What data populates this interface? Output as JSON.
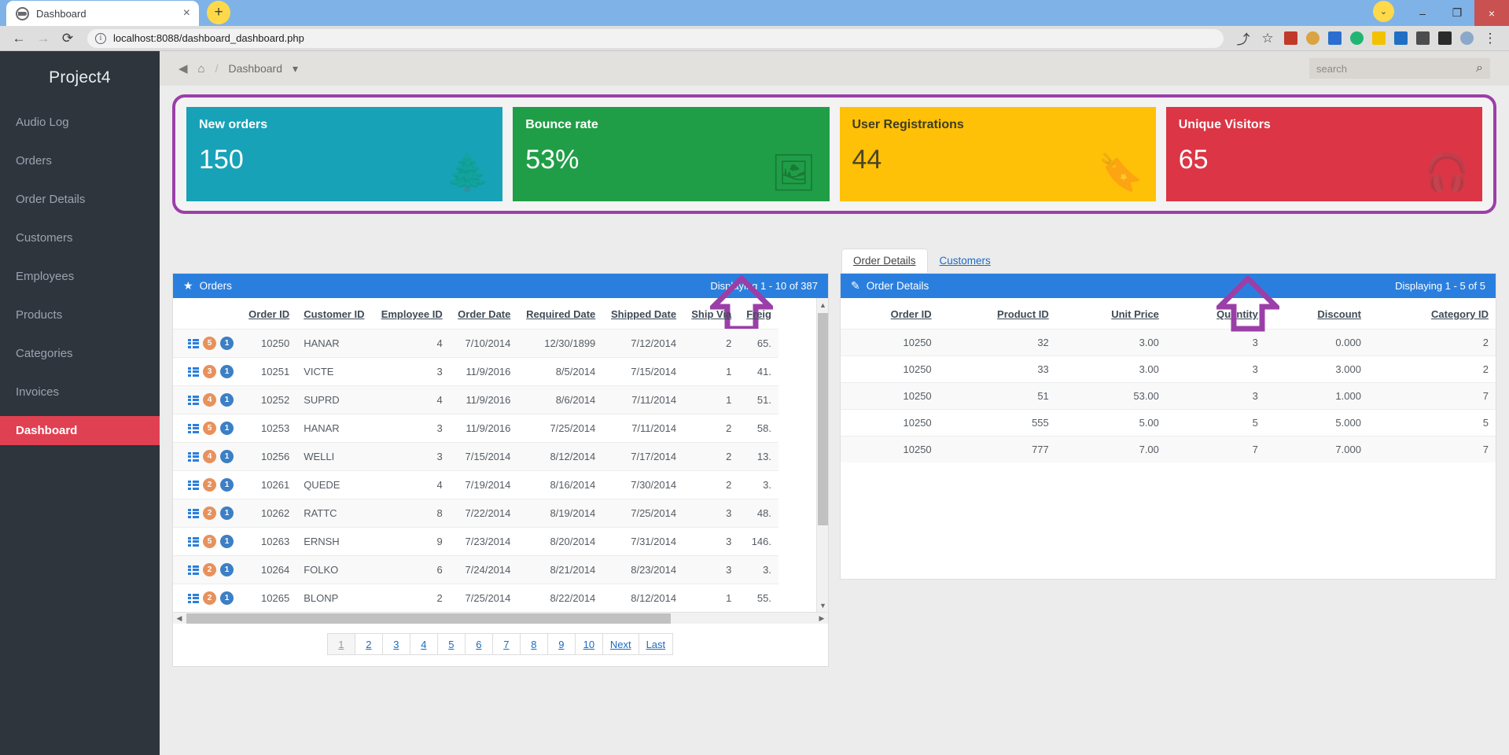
{
  "browser": {
    "tab_title": "Dashboard",
    "tab_favicon": "globe-icon",
    "new_tab_label": "+",
    "close_tab_label": "×",
    "url": "localhost:8088/dashboard_dashboard.php",
    "back_label": "←",
    "forward_label": "→",
    "reload_label": "⟳",
    "info_label": "i",
    "share_label": "⤴",
    "star_label": "☆",
    "minimize_label": "–",
    "maximize_label": "❐",
    "close_label": "×",
    "profile_menu_label": "⌄",
    "overflow_label": "⋮",
    "extensions": [
      {
        "name": "dictionary-extension-icon",
        "glyph": "📕",
        "color": "#C0392B"
      },
      {
        "name": "cookie-extension-icon",
        "glyph": "🍪",
        "color": "#D9A441"
      },
      {
        "name": "adblock-extension-icon",
        "glyph": "a",
        "color": "#2A6FD0"
      },
      {
        "name": "vpn-off-extension-icon",
        "glyph": "◔",
        "color": "#21B573"
      },
      {
        "name": "notes-extension-icon",
        "glyph": "⋯",
        "color": "#F2C200"
      },
      {
        "name": "new-extension-icon",
        "glyph": "NEW",
        "color": "#1F6FC4"
      },
      {
        "name": "puzzle-extensions-icon",
        "glyph": "🧩",
        "color": "#4d4d4d"
      },
      {
        "name": "sidepanel-icon",
        "glyph": "▣",
        "color": "#2b2b2b"
      },
      {
        "name": "profile-avatar-icon",
        "glyph": "🏄",
        "color": "#8aa9c9"
      }
    ]
  },
  "sidebar": {
    "brand": "Project4",
    "items": [
      {
        "label": "Audio Log",
        "active": false
      },
      {
        "label": "Orders",
        "active": false
      },
      {
        "label": "Order Details",
        "active": false
      },
      {
        "label": "Customers",
        "active": false
      },
      {
        "label": "Employees",
        "active": false
      },
      {
        "label": "Products",
        "active": false
      },
      {
        "label": "Categories",
        "active": false
      },
      {
        "label": "Invoices",
        "active": false
      },
      {
        "label": "Dashboard",
        "active": true
      }
    ],
    "active_color": "#E04152",
    "bg_color": "#2E353D"
  },
  "topbar": {
    "back_icon": "◀",
    "home_icon": "⌂",
    "separator": "/",
    "breadcrumb": "Dashboard",
    "caret": "▾",
    "search_placeholder": "search",
    "search_value": "",
    "search_icon": "⌕"
  },
  "stats": {
    "highlight_border_color": "#9B3FA8",
    "boxes": [
      {
        "title": "New orders",
        "value": "150",
        "color": "#17A2B8",
        "icon": "tree-icon",
        "glyph": "🌲"
      },
      {
        "title": "Bounce rate",
        "value": "53%",
        "color": "#209E47",
        "icon": "image-icon",
        "glyph": "🖼"
      },
      {
        "title": "User Registrations",
        "value": "44",
        "color": "#FFC107",
        "icon": "bookmark-icon",
        "glyph": "🔖"
      },
      {
        "title": "Unique Visitors",
        "value": "65",
        "color": "#DC3545",
        "icon": "headphones-icon",
        "glyph": "🎧"
      }
    ]
  },
  "orders_panel": {
    "icon": "star-icon",
    "glyph": "★",
    "title": "Orders",
    "displaying": "Displaying 1 - 10 of 387",
    "columns": [
      "Order ID",
      "Customer ID",
      "Employee ID",
      "Order Date",
      "Required Date",
      "Shipped Date",
      "Ship Via",
      "Freig"
    ],
    "rows": [
      {
        "badges": [
          "5",
          "1"
        ],
        "order_id": "10250",
        "customer_id": "HANAR",
        "employee_id": "4",
        "order_date": "7/10/2014",
        "required_date": "12/30/1899",
        "shipped_date": "7/12/2014",
        "ship_via": "2",
        "freight": "65."
      },
      {
        "badges": [
          "3",
          "1"
        ],
        "order_id": "10251",
        "customer_id": "VICTE",
        "employee_id": "3",
        "order_date": "11/9/2016",
        "required_date": "8/5/2014",
        "shipped_date": "7/15/2014",
        "ship_via": "1",
        "freight": "41."
      },
      {
        "badges": [
          "4",
          "1"
        ],
        "order_id": "10252",
        "customer_id": "SUPRD",
        "employee_id": "4",
        "order_date": "11/9/2016",
        "required_date": "8/6/2014",
        "shipped_date": "7/11/2014",
        "ship_via": "1",
        "freight": "51."
      },
      {
        "badges": [
          "5",
          "1"
        ],
        "order_id": "10253",
        "customer_id": "HANAR",
        "employee_id": "3",
        "order_date": "11/9/2016",
        "required_date": "7/25/2014",
        "shipped_date": "7/11/2014",
        "ship_via": "2",
        "freight": "58."
      },
      {
        "badges": [
          "4",
          "1"
        ],
        "order_id": "10256",
        "customer_id": "WELLI",
        "employee_id": "3",
        "order_date": "7/15/2014",
        "required_date": "8/12/2014",
        "shipped_date": "7/17/2014",
        "ship_via": "2",
        "freight": "13."
      },
      {
        "badges": [
          "2",
          "1"
        ],
        "order_id": "10261",
        "customer_id": "QUEDE",
        "employee_id": "4",
        "order_date": "7/19/2014",
        "required_date": "8/16/2014",
        "shipped_date": "7/30/2014",
        "ship_via": "2",
        "freight": "3."
      },
      {
        "badges": [
          "2",
          "1"
        ],
        "order_id": "10262",
        "customer_id": "RATTC",
        "employee_id": "8",
        "order_date": "7/22/2014",
        "required_date": "8/19/2014",
        "shipped_date": "7/25/2014",
        "ship_via": "3",
        "freight": "48."
      },
      {
        "badges": [
          "5",
          "1"
        ],
        "order_id": "10263",
        "customer_id": "ERNSH",
        "employee_id": "9",
        "order_date": "7/23/2014",
        "required_date": "8/20/2014",
        "shipped_date": "7/31/2014",
        "ship_via": "3",
        "freight": "146."
      },
      {
        "badges": [
          "2",
          "1"
        ],
        "order_id": "10264",
        "customer_id": "FOLKO",
        "employee_id": "6",
        "order_date": "7/24/2014",
        "required_date": "8/21/2014",
        "shipped_date": "8/23/2014",
        "ship_via": "3",
        "freight": "3."
      },
      {
        "badges": [
          "2",
          "1"
        ],
        "order_id": "10265",
        "customer_id": "BLONP",
        "employee_id": "2",
        "order_date": "7/25/2014",
        "required_date": "8/22/2014",
        "shipped_date": "8/12/2014",
        "ship_via": "1",
        "freight": "55."
      }
    ],
    "pagination": [
      "1",
      "2",
      "3",
      "4",
      "5",
      "6",
      "7",
      "8",
      "9",
      "10",
      "Next",
      "Last"
    ],
    "current_page": "1"
  },
  "details_panel": {
    "tabs": [
      {
        "label": "Order Details",
        "active": true
      },
      {
        "label": "Customers",
        "active": false
      }
    ],
    "icon": "feather-icon",
    "glyph": "✎",
    "title": "Order Details",
    "displaying": "Displaying 1 - 5 of 5",
    "columns": [
      "Order ID",
      "Product ID",
      "Unit Price",
      "Quantity",
      "Discount",
      "Category ID"
    ],
    "rows": [
      [
        "10250",
        "32",
        "3.00",
        "3",
        "0.000",
        "2"
      ],
      [
        "10250",
        "33",
        "3.00",
        "3",
        "3.000",
        "2"
      ],
      [
        "10250",
        "51",
        "53.00",
        "3",
        "1.000",
        "7"
      ],
      [
        "10250",
        "555",
        "5.00",
        "5",
        "5.000",
        "5"
      ],
      [
        "10250",
        "777",
        "7.00",
        "7",
        "7.000",
        "7"
      ]
    ]
  },
  "annotations": {
    "arrow_color": "#9B3FA8",
    "arrows": [
      "up-arrow-annotation-left",
      "up-arrow-annotation-right"
    ]
  }
}
